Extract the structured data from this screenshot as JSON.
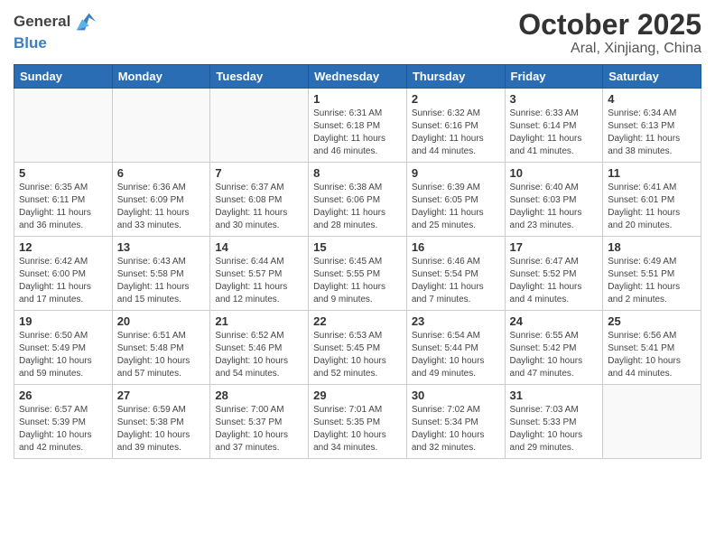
{
  "header": {
    "logo_general": "General",
    "logo_blue": "Blue",
    "month": "October 2025",
    "location": "Aral, Xinjiang, China"
  },
  "days_of_week": [
    "Sunday",
    "Monday",
    "Tuesday",
    "Wednesday",
    "Thursday",
    "Friday",
    "Saturday"
  ],
  "weeks": [
    [
      {
        "day": "",
        "info": ""
      },
      {
        "day": "",
        "info": ""
      },
      {
        "day": "",
        "info": ""
      },
      {
        "day": "1",
        "info": "Sunrise: 6:31 AM\nSunset: 6:18 PM\nDaylight: 11 hours\nand 46 minutes."
      },
      {
        "day": "2",
        "info": "Sunrise: 6:32 AM\nSunset: 6:16 PM\nDaylight: 11 hours\nand 44 minutes."
      },
      {
        "day": "3",
        "info": "Sunrise: 6:33 AM\nSunset: 6:14 PM\nDaylight: 11 hours\nand 41 minutes."
      },
      {
        "day": "4",
        "info": "Sunrise: 6:34 AM\nSunset: 6:13 PM\nDaylight: 11 hours\nand 38 minutes."
      }
    ],
    [
      {
        "day": "5",
        "info": "Sunrise: 6:35 AM\nSunset: 6:11 PM\nDaylight: 11 hours\nand 36 minutes."
      },
      {
        "day": "6",
        "info": "Sunrise: 6:36 AM\nSunset: 6:09 PM\nDaylight: 11 hours\nand 33 minutes."
      },
      {
        "day": "7",
        "info": "Sunrise: 6:37 AM\nSunset: 6:08 PM\nDaylight: 11 hours\nand 30 minutes."
      },
      {
        "day": "8",
        "info": "Sunrise: 6:38 AM\nSunset: 6:06 PM\nDaylight: 11 hours\nand 28 minutes."
      },
      {
        "day": "9",
        "info": "Sunrise: 6:39 AM\nSunset: 6:05 PM\nDaylight: 11 hours\nand 25 minutes."
      },
      {
        "day": "10",
        "info": "Sunrise: 6:40 AM\nSunset: 6:03 PM\nDaylight: 11 hours\nand 23 minutes."
      },
      {
        "day": "11",
        "info": "Sunrise: 6:41 AM\nSunset: 6:01 PM\nDaylight: 11 hours\nand 20 minutes."
      }
    ],
    [
      {
        "day": "12",
        "info": "Sunrise: 6:42 AM\nSunset: 6:00 PM\nDaylight: 11 hours\nand 17 minutes."
      },
      {
        "day": "13",
        "info": "Sunrise: 6:43 AM\nSunset: 5:58 PM\nDaylight: 11 hours\nand 15 minutes."
      },
      {
        "day": "14",
        "info": "Sunrise: 6:44 AM\nSunset: 5:57 PM\nDaylight: 11 hours\nand 12 minutes."
      },
      {
        "day": "15",
        "info": "Sunrise: 6:45 AM\nSunset: 5:55 PM\nDaylight: 11 hours\nand 9 minutes."
      },
      {
        "day": "16",
        "info": "Sunrise: 6:46 AM\nSunset: 5:54 PM\nDaylight: 11 hours\nand 7 minutes."
      },
      {
        "day": "17",
        "info": "Sunrise: 6:47 AM\nSunset: 5:52 PM\nDaylight: 11 hours\nand 4 minutes."
      },
      {
        "day": "18",
        "info": "Sunrise: 6:49 AM\nSunset: 5:51 PM\nDaylight: 11 hours\nand 2 minutes."
      }
    ],
    [
      {
        "day": "19",
        "info": "Sunrise: 6:50 AM\nSunset: 5:49 PM\nDaylight: 10 hours\nand 59 minutes."
      },
      {
        "day": "20",
        "info": "Sunrise: 6:51 AM\nSunset: 5:48 PM\nDaylight: 10 hours\nand 57 minutes."
      },
      {
        "day": "21",
        "info": "Sunrise: 6:52 AM\nSunset: 5:46 PM\nDaylight: 10 hours\nand 54 minutes."
      },
      {
        "day": "22",
        "info": "Sunrise: 6:53 AM\nSunset: 5:45 PM\nDaylight: 10 hours\nand 52 minutes."
      },
      {
        "day": "23",
        "info": "Sunrise: 6:54 AM\nSunset: 5:44 PM\nDaylight: 10 hours\nand 49 minutes."
      },
      {
        "day": "24",
        "info": "Sunrise: 6:55 AM\nSunset: 5:42 PM\nDaylight: 10 hours\nand 47 minutes."
      },
      {
        "day": "25",
        "info": "Sunrise: 6:56 AM\nSunset: 5:41 PM\nDaylight: 10 hours\nand 44 minutes."
      }
    ],
    [
      {
        "day": "26",
        "info": "Sunrise: 6:57 AM\nSunset: 5:39 PM\nDaylight: 10 hours\nand 42 minutes."
      },
      {
        "day": "27",
        "info": "Sunrise: 6:59 AM\nSunset: 5:38 PM\nDaylight: 10 hours\nand 39 minutes."
      },
      {
        "day": "28",
        "info": "Sunrise: 7:00 AM\nSunset: 5:37 PM\nDaylight: 10 hours\nand 37 minutes."
      },
      {
        "day": "29",
        "info": "Sunrise: 7:01 AM\nSunset: 5:35 PM\nDaylight: 10 hours\nand 34 minutes."
      },
      {
        "day": "30",
        "info": "Sunrise: 7:02 AM\nSunset: 5:34 PM\nDaylight: 10 hours\nand 32 minutes."
      },
      {
        "day": "31",
        "info": "Sunrise: 7:03 AM\nSunset: 5:33 PM\nDaylight: 10 hours\nand 29 minutes."
      },
      {
        "day": "",
        "info": ""
      }
    ]
  ]
}
